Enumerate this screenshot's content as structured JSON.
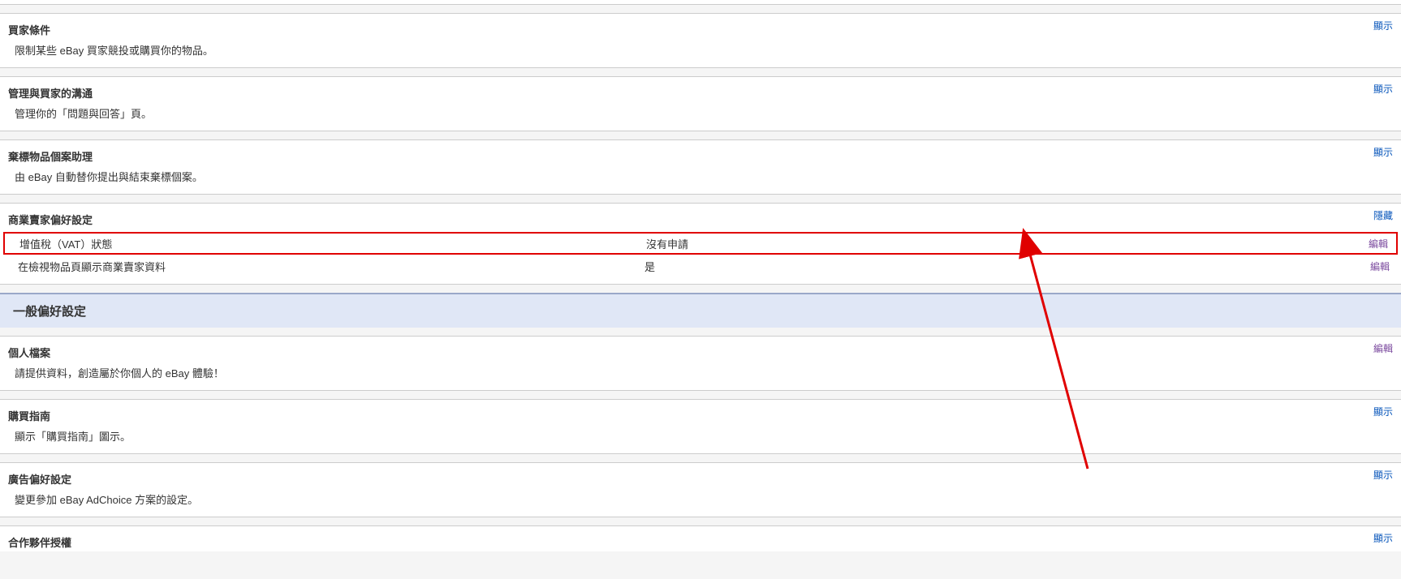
{
  "actions": {
    "show": "顯示",
    "hide": "隱藏",
    "edit": "編輯"
  },
  "sections": {
    "buyerRequirements": {
      "title": "買家條件",
      "desc": "限制某些 eBay 買家競投或購買你的物品。"
    },
    "manageCommunication": {
      "title": "管理與買家的溝通",
      "desc": "管理你的「問題與回答」頁。"
    },
    "abandonedItemAssistant": {
      "title": "棄標物品個案助理",
      "desc": "由 eBay 自動替你提出與結束棄標個案。"
    },
    "businessSellerPrefs": {
      "title": "商業賣家偏好設定",
      "rows": [
        {
          "label": "增值稅（VAT）狀態",
          "value": "沒有申請"
        },
        {
          "label": "在檢視物品頁顯示商業賣家資料",
          "value": "是"
        }
      ]
    }
  },
  "generalHeader": "一般偏好設定",
  "generalSections": {
    "personalProfile": {
      "title": "個人檔案",
      "desc": "請提供資料，創造屬於你個人的 eBay 體驗！"
    },
    "buyingGuide": {
      "title": "購買指南",
      "desc": "顯示「購買指南」圖示。"
    },
    "adPreferences": {
      "title": "廣告偏好設定",
      "desc": "變更參加 eBay AdChoice 方案的設定。"
    },
    "partnerAuth": {
      "title": "合作夥伴授權"
    }
  }
}
